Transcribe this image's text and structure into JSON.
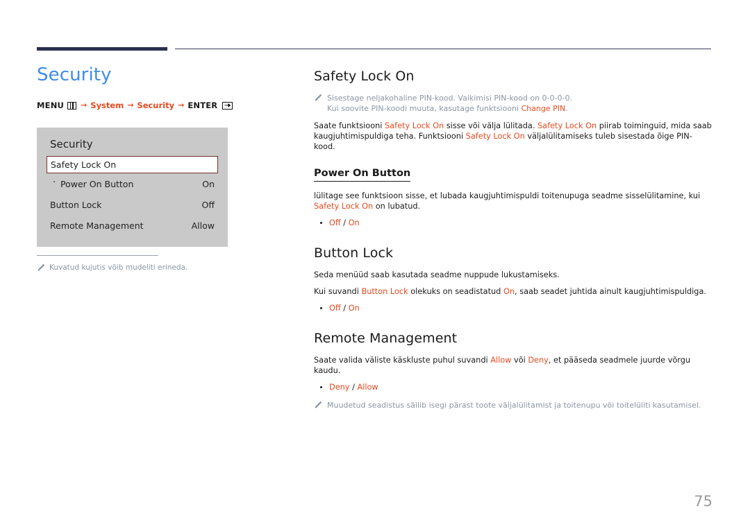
{
  "header": {
    "rule_thick_color": "#2b3050",
    "rule_thin_color": "#3a3f5c"
  },
  "left": {
    "page_title": "Security",
    "title_color": "#3f8ce8",
    "breadcrumb": {
      "menu_label": "MENU",
      "menu_icon": "menu-grid-icon",
      "arrow1": "→",
      "item1": "System",
      "arrow2": "→",
      "item2": "Security",
      "arrow3": "→",
      "enter_label": "ENTER",
      "enter_icon": "enter-key-icon"
    },
    "osd": {
      "title": "Security",
      "rows": [
        {
          "label": "Safety Lock On",
          "value": "",
          "selected": true,
          "sub": false
        },
        {
          "label": "Power On Button",
          "value": "On",
          "selected": false,
          "sub": true
        },
        {
          "label": "Button Lock",
          "value": "Off",
          "selected": false,
          "sub": false
        },
        {
          "label": "Remote Management",
          "value": "Allow",
          "selected": false,
          "sub": false
        }
      ]
    },
    "note": {
      "icon": "pencil-icon",
      "text": "Kuvatud kujutis võib mudeliti erineda."
    }
  },
  "right": {
    "sections": [
      {
        "heading": "Safety Lock On",
        "note": {
          "icon": "pencil-icon",
          "line1": "Sisestage neljakohaline PIN-kood. Vaikimisi PIN-kood on 0-0-0-0.",
          "line2_pre": "Kui soovite PIN-koodi muuta, kasutage funktsiooni ",
          "line2_red": "Change PIN",
          "line2_post": "."
        },
        "para": {
          "t1": "Saate funktsiooni ",
          "r1": "Safety Lock On",
          "t2": " sisse või välja lülitada. ",
          "r2": "Safety Lock On",
          "t3": " piirab toiminguid, mida saab kaugjuhtimispuldiga teha. Funktsiooni ",
          "r3": "Safety Lock On",
          "t4": " väljalülitamiseks tuleb sisestada õige PIN-kood."
        },
        "sub": {
          "heading": "Power On Button",
          "para": {
            "t1": "lülitage see funktsioon sisse, et lubada kaugjuhtimispuldi toitenupuga seadme sisselülitamine, kui ",
            "r1": "Safety Lock On",
            "t2": " on lubatud."
          },
          "bullet": {
            "opt1": "Off",
            "sep": " / ",
            "opt2": "On"
          }
        }
      },
      {
        "heading": "Button Lock",
        "para1": "Seda menüüd saab kasutada seadme nuppude lukustamiseks.",
        "para2": {
          "t1": "Kui suvandi ",
          "r1": "Button Lock",
          "t2": " olekuks on seadistatud ",
          "r2": "On",
          "t3": ", saab seadet juhtida ainult kaugjuhtimispuldiga."
        },
        "bullet": {
          "opt1": "Off",
          "sep": " / ",
          "opt2": "On"
        }
      },
      {
        "heading": "Remote Management",
        "para": {
          "t1": "Saate valida väliste käskluste puhul suvandi ",
          "r1": "Allow",
          "t2": " või ",
          "r2": "Deny",
          "t3": ", et pääseda seadmele juurde võrgu kaudu."
        },
        "bullet": {
          "opt1": "Deny",
          "sep": " / ",
          "opt2": "Allow"
        },
        "note": {
          "icon": "pencil-icon",
          "text": "Muudetud seadistus säilib isegi pärast toote väljalülitamist ja toitenupu või toitelüliti kasutamisel."
        }
      }
    ]
  },
  "footer": {
    "page_number": "75"
  },
  "colors": {
    "accent_red": "#e8491e",
    "title_blue": "#3f8ce8",
    "note_gray": "#8b96a5",
    "osd_bg": "#c9c9c9",
    "rule_navy": "#2b3050"
  }
}
